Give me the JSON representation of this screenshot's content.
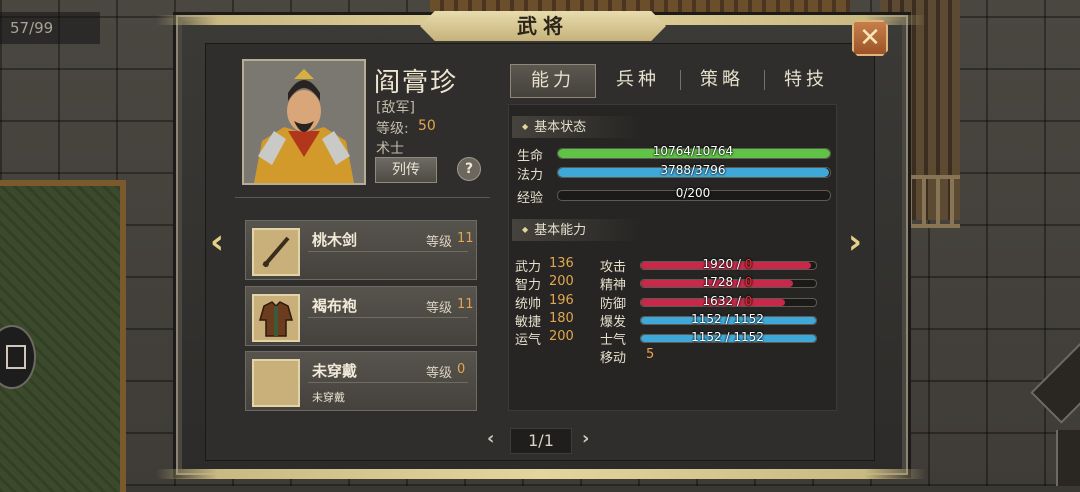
{
  "background": {
    "counter": "57/99"
  },
  "dialog": {
    "title": "武将",
    "close_icon": "close-x-icon"
  },
  "hero": {
    "name": "阎膏珍",
    "faction": "[敌军]",
    "level_label": "等级:",
    "level": "50",
    "class": "术士",
    "bio_button": "列传",
    "help_button": "?"
  },
  "equipment": [
    {
      "name": "桃木剑",
      "level_label": "等级",
      "level": "11",
      "sub": "",
      "icon": "wooden-sword-icon"
    },
    {
      "name": "褐布袍",
      "level_label": "等级",
      "level": "11",
      "sub": "",
      "icon": "cloth-robe-icon"
    },
    {
      "name": "未穿戴",
      "level_label": "等级",
      "level": "0",
      "sub": "未穿戴",
      "icon": "empty-slot-icon"
    }
  ],
  "tabs": [
    {
      "label": "能力",
      "active": true
    },
    {
      "label": "兵种",
      "active": false
    },
    {
      "label": "策略",
      "active": false
    },
    {
      "label": "特技",
      "active": false
    }
  ],
  "basic_status": {
    "header": "基本状态",
    "bars": [
      {
        "label": "生命",
        "text": "10764/10764",
        "current": 10764,
        "max": 10764,
        "color": "#5ec347"
      },
      {
        "label": "法力",
        "text": "3788/3796",
        "current": 3788,
        "max": 3796,
        "color": "#3ea8d8"
      },
      {
        "label": "经验",
        "text": "0/200",
        "current": 0,
        "max": 200,
        "color": "#e2a650"
      }
    ]
  },
  "basic_ability": {
    "header": "基本能力",
    "attributes": [
      {
        "label": "武力",
        "value": "136"
      },
      {
        "label": "智力",
        "value": "200"
      },
      {
        "label": "统帅",
        "value": "196"
      },
      {
        "label": "敏捷",
        "value": "180"
      },
      {
        "label": "运气",
        "value": "200"
      }
    ],
    "stats": [
      {
        "label": "攻击",
        "base": "1920",
        "sep": "/",
        "bonus": "0",
        "fraction": 0.97,
        "color": "#c8284a"
      },
      {
        "label": "精神",
        "base": "1728",
        "sep": "/",
        "bonus": "0",
        "fraction": 0.87,
        "color": "#c8284a"
      },
      {
        "label": "防御",
        "base": "1632",
        "sep": "/",
        "bonus": "0",
        "fraction": 0.82,
        "color": "#c8284a"
      },
      {
        "label": "爆发",
        "base": "1152",
        "sep": "/",
        "bonus": "1152",
        "fraction": 1.0,
        "color": "#3ea8d8"
      },
      {
        "label": "士气",
        "base": "1152",
        "sep": "/",
        "bonus": "1152",
        "fraction": 1.0,
        "color": "#3ea8d8"
      }
    ],
    "move_label": "移动",
    "move_value": "5"
  },
  "pager": {
    "text": "1/1"
  }
}
